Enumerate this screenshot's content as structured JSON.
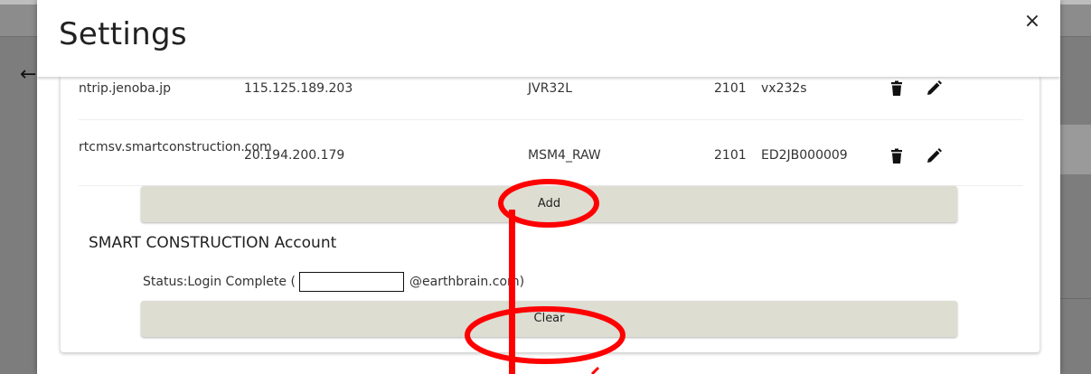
{
  "dialog": {
    "title": "Settings",
    "close_label": "×"
  },
  "ntrip_rows": [
    {
      "host": "ntrip.jenoba.jp",
      "ip": "115.125.189.203",
      "mountpoint": "JVR32L",
      "port": "2101",
      "user": "vx232s"
    },
    {
      "host": "rtcmsv.smartconstruction.com",
      "ip": "20.194.200.179",
      "mountpoint": "MSM4_RAW",
      "port": "2101",
      "user": "ED2JB000009"
    }
  ],
  "add_button": {
    "label": "Add"
  },
  "account": {
    "title": "SMART CONSTRUCTION Account",
    "status_prefix": "Status:Login Complete (",
    "status_email_suffix": "@earthbrain.com)"
  },
  "clear_button": {
    "label": "Clear"
  },
  "background": {
    "back_arrow": "←"
  },
  "colors": {
    "annotation_red": "#ff0000",
    "button_bg": "#ddddd2"
  },
  "icons": {
    "delete": "trash-icon",
    "edit": "pencil-icon",
    "close": "close-icon",
    "back": "arrow-left-icon"
  }
}
